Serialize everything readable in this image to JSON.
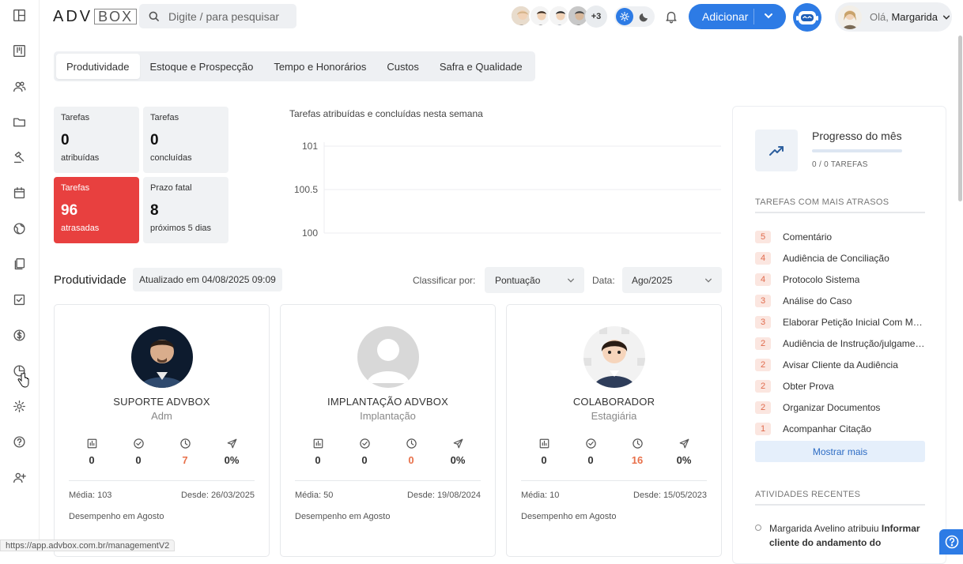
{
  "header": {
    "logo_left": "ADV",
    "logo_right": "BOX",
    "search_placeholder": "Digite / para pesquisar",
    "avatars_more": "+3",
    "add_label": "Adicionar",
    "greeting_prefix": "Olá,",
    "user_name": "Margarida"
  },
  "tabs": [
    {
      "label": "Produtividade",
      "active": true
    },
    {
      "label": "Estoque e Prospecção",
      "active": false
    },
    {
      "label": "Tempo e Honorários",
      "active": false
    },
    {
      "label": "Custos",
      "active": false
    },
    {
      "label": "Safra e Qualidade",
      "active": false
    }
  ],
  "stats": [
    {
      "title": "Tarefas",
      "value": "0",
      "sub": "atribuídas",
      "style": "normal"
    },
    {
      "title": "Tarefas",
      "value": "0",
      "sub": "concluídas",
      "style": "normal"
    },
    {
      "title": "Tarefas",
      "value": "96",
      "sub": "atrasadas",
      "style": "red"
    },
    {
      "title": "Prazo fatal",
      "value": "8",
      "sub": "próximos 5 dias",
      "style": "normal"
    }
  ],
  "chart_data": {
    "type": "line",
    "title": "Tarefas atribuídas e concluídas nesta semana",
    "series": [],
    "yticks": [
      "101",
      "100.5",
      "100"
    ],
    "ylim": [
      100,
      101
    ],
    "grid": true
  },
  "produtividade": {
    "title": "Produtividade",
    "updated": "Atualizado em 04/08/2025 09:09",
    "sort_label": "Classificar por:",
    "sort_value": "Pontuação",
    "date_label": "Data:",
    "date_value": "Ago/2025"
  },
  "people": [
    {
      "name": "SUPORTE ADVBOX",
      "role": "Adm",
      "metrics": [
        "0",
        "0",
        "7",
        "0%"
      ],
      "media": "Média: 103",
      "desde": "Desde: 26/03/2025",
      "desempenho": "Desempenho em Agosto"
    },
    {
      "name": "IMPLANTAÇÃO ADVBOX",
      "role": "Implantação",
      "metrics": [
        "0",
        "0",
        "0",
        "0%"
      ],
      "media": "Média: 50",
      "desde": "Desde: 19/08/2024",
      "desempenho": "Desempenho em Agosto"
    },
    {
      "name": "COLABORADOR",
      "role": "Estagiária",
      "metrics": [
        "0",
        "0",
        "16",
        "0%"
      ],
      "media": "Média: 10",
      "desde": "Desde: 15/05/2023",
      "desempenho": "Desempenho em Agosto"
    }
  ],
  "right_panel": {
    "progress_title": "Progresso do mês",
    "progress_count": "0 / 0 TAREFAS",
    "progress_fraction": 0,
    "late_heading": "TAREFAS COM MAIS ATRASOS",
    "late_tasks": [
      {
        "count": "5",
        "label": "Comentário"
      },
      {
        "count": "4",
        "label": "Audiência de Conciliação"
      },
      {
        "count": "4",
        "label": "Protocolo Sistema"
      },
      {
        "count": "3",
        "label": "Análise do Caso"
      },
      {
        "count": "3",
        "label": "Elaborar Petição Inicial Com Modelo"
      },
      {
        "count": "2",
        "label": "Audiência de Instrução/julgamento"
      },
      {
        "count": "2",
        "label": "Avisar Cliente da Audiência"
      },
      {
        "count": "2",
        "label": "Obter Prova"
      },
      {
        "count": "2",
        "label": "Organizar Documentos"
      },
      {
        "count": "1",
        "label": "Acompanhar Citação"
      }
    ],
    "more_label": "Mostrar mais",
    "activity_heading": "ATIVIDADES RECENTES",
    "activity_text": "Margarida Avelino atribuiu ",
    "activity_bold": "Informar cliente do andamento do"
  },
  "status_url": "https://app.advbox.com.br/managementV2",
  "colors": {
    "primary": "#2d7be5",
    "danger": "#e8403f",
    "warning": "#e8704a"
  }
}
